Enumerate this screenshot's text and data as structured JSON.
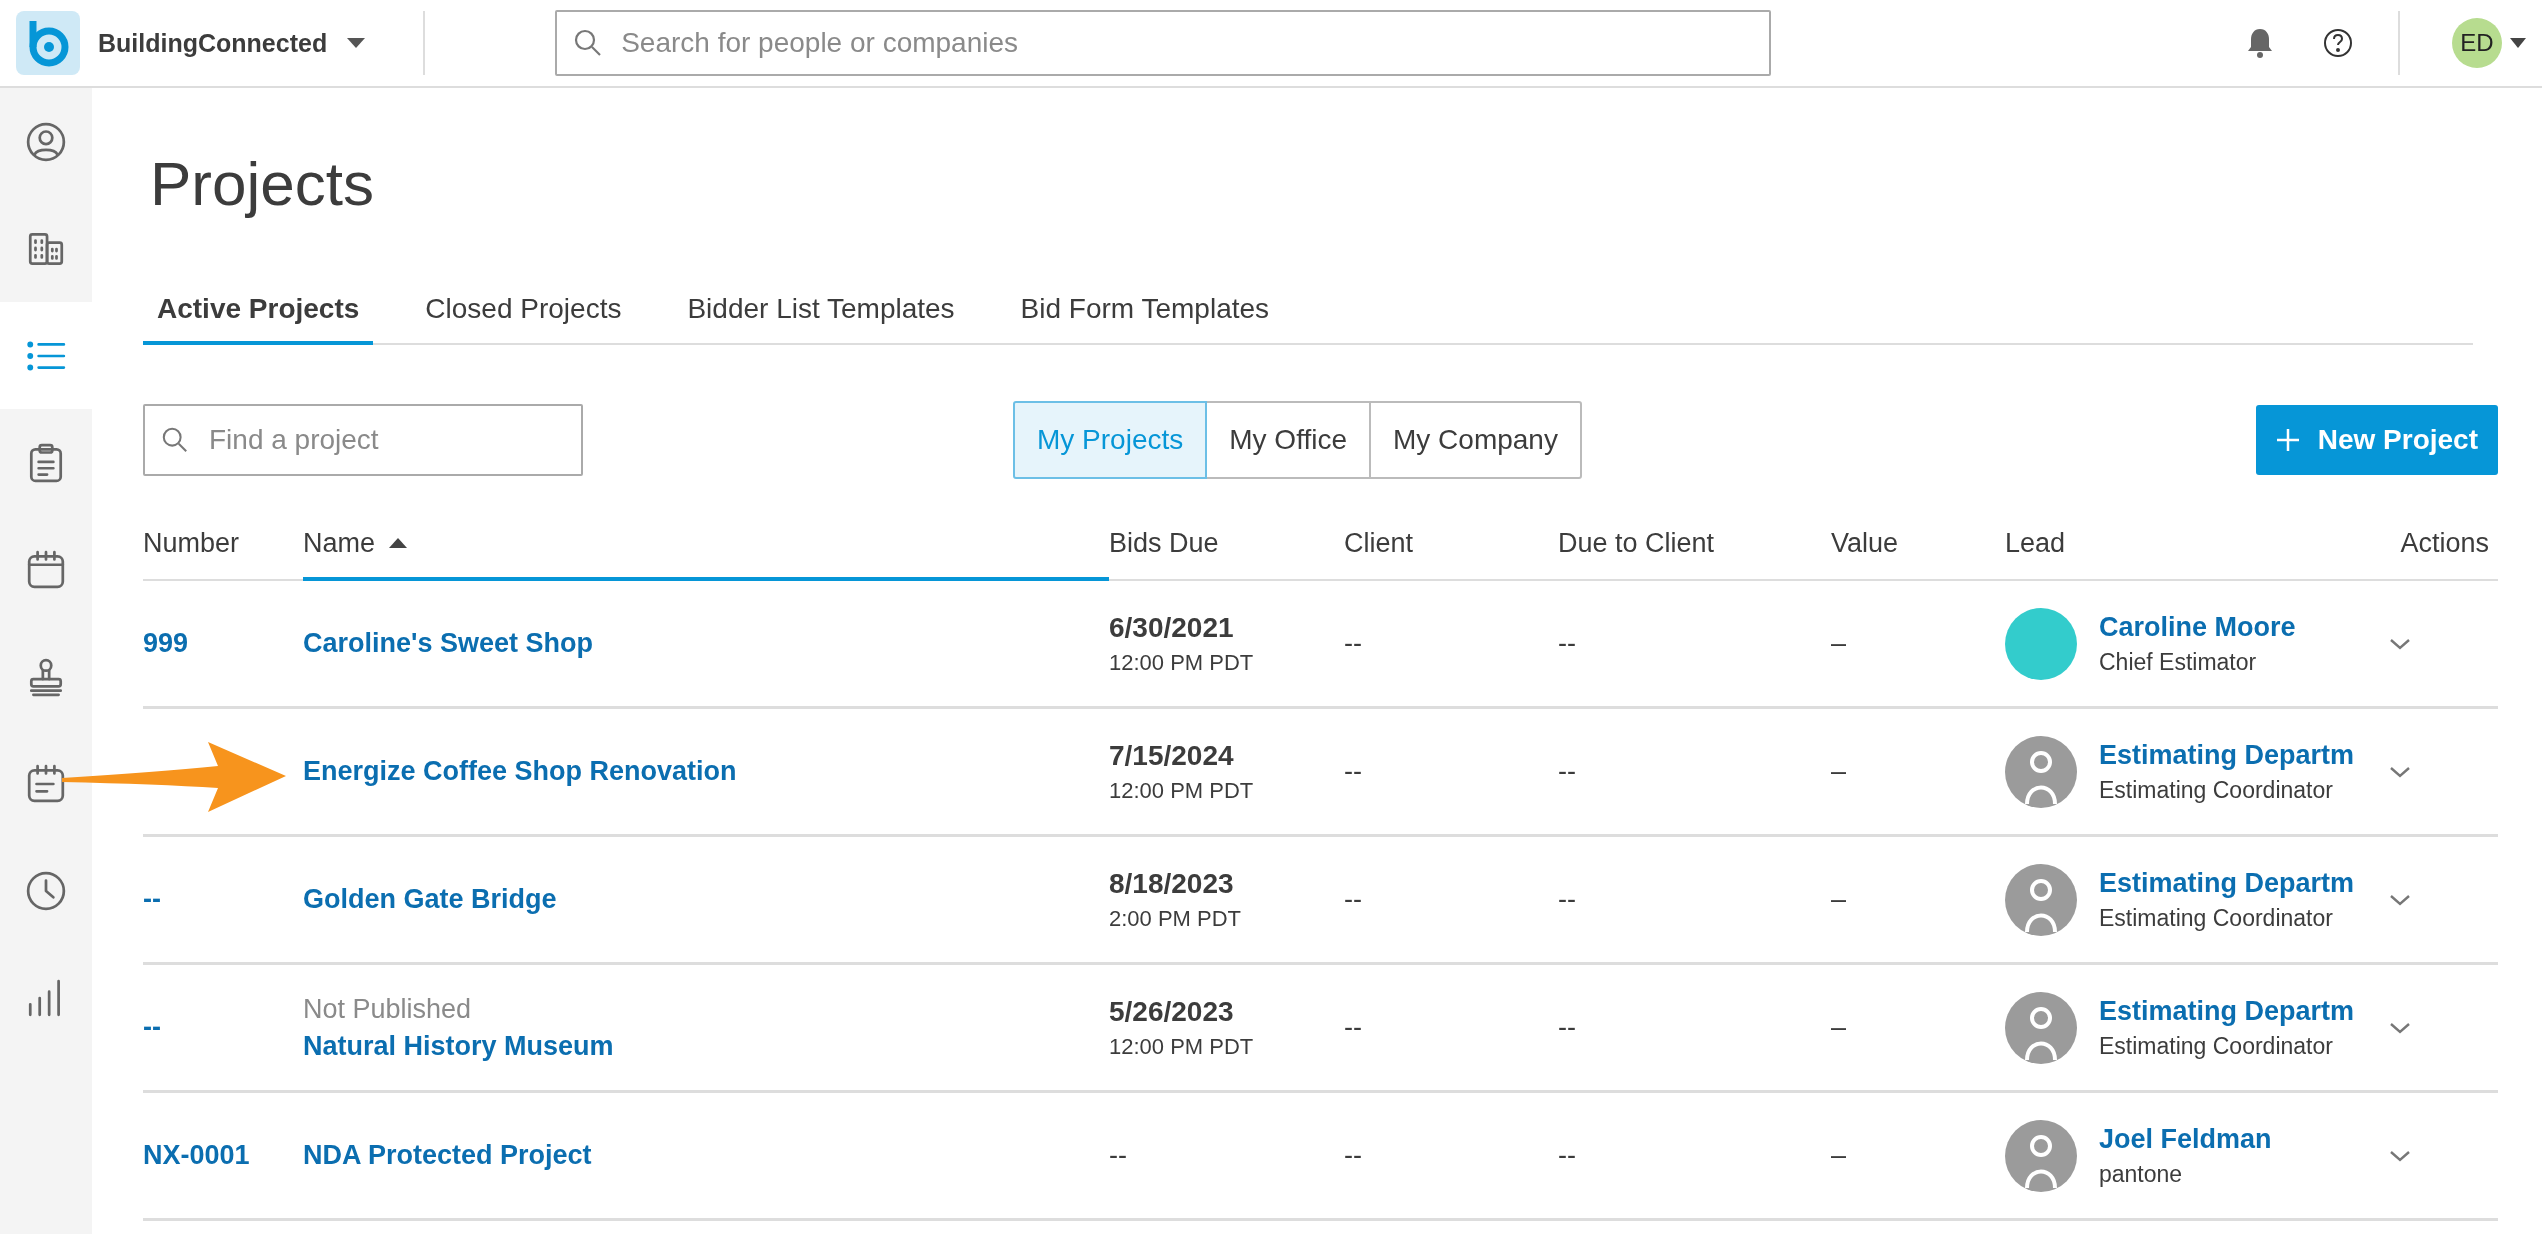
{
  "topbar": {
    "brand": "BuildingConnected",
    "search": {
      "placeholder": "Search for people or companies"
    },
    "user_initials": "ED"
  },
  "sidebar": {
    "items": [
      {
        "kind": "profile",
        "selected": false
      },
      {
        "kind": "buildings",
        "selected": false
      },
      {
        "kind": "list",
        "selected": true
      },
      {
        "kind": "clipboard",
        "selected": false
      },
      {
        "kind": "calendar",
        "selected": false
      },
      {
        "kind": "stamp",
        "selected": false
      },
      {
        "kind": "schedule",
        "selected": false
      },
      {
        "kind": "clock",
        "selected": false
      },
      {
        "kind": "chart",
        "selected": false
      }
    ]
  },
  "page": {
    "title": "Projects"
  },
  "tabs": [
    {
      "label": "Active Projects",
      "selected": true
    },
    {
      "label": "Closed Projects",
      "selected": false
    },
    {
      "label": "Bidder List Templates",
      "selected": false
    },
    {
      "label": "Bid Form Templates",
      "selected": false
    }
  ],
  "filter": {
    "placeholder": "Find a project"
  },
  "scope": [
    {
      "label": "My Projects",
      "selected": true
    },
    {
      "label": "My Office",
      "selected": false
    },
    {
      "label": "My Company",
      "selected": false
    }
  ],
  "new_button": {
    "label": "New Project"
  },
  "table": {
    "columns": [
      {
        "label": "Number",
        "sorted": false
      },
      {
        "label": "Name",
        "sorted": true
      },
      {
        "label": "Bids Due",
        "sorted": false
      },
      {
        "label": "Client",
        "sorted": false
      },
      {
        "label": "Due to Client",
        "sorted": false
      },
      {
        "label": "Value",
        "sorted": false
      },
      {
        "label": "Lead",
        "sorted": false
      },
      {
        "label": "Actions",
        "sorted": false
      }
    ],
    "rows": [
      {
        "number": "999",
        "name": "Caroline's Sweet Shop",
        "bids_due": "6/30/2021",
        "bids_due_time": "12:00 PM PDT",
        "client": "--",
        "due_to_client": "--",
        "value": "–",
        "lead": {
          "name": "Caroline Moore",
          "role": "Chief Estimator",
          "photo": true
        }
      },
      {
        "name": "Energize Coffee Shop Renovation",
        "bids_due": "7/15/2024",
        "bids_due_time": "12:00 PM PDT",
        "client": "--",
        "due_to_client": "--",
        "value": "–",
        "lead": {
          "name": "Estimating Departm",
          "role": "Estimating Coordinator",
          "photo": false
        }
      },
      {
        "number": "--",
        "name": "Golden Gate Bridge",
        "bids_due": "8/18/2023",
        "bids_due_time": "2:00 PM PDT",
        "client": "--",
        "due_to_client": "--",
        "value": "–",
        "lead": {
          "name": "Estimating Departm",
          "role": "Estimating Coordinator",
          "photo": false
        }
      },
      {
        "number": "--",
        "status": "Not Published",
        "name": "Natural History Museum",
        "bids_due": "5/26/2023",
        "bids_due_time": "12:00 PM PDT",
        "client": "--",
        "due_to_client": "--",
        "value": "–",
        "lead": {
          "name": "Estimating Departm",
          "role": "Estimating Coordinator",
          "photo": false
        }
      },
      {
        "number": "NX-0001",
        "name": "NDA Protected Project",
        "bids_due_plain": "--",
        "client": "--",
        "due_to_client": "--",
        "value": "–",
        "lead": {
          "name": "Joel Feldman",
          "role": "pantone",
          "photo": false
        }
      }
    ]
  }
}
